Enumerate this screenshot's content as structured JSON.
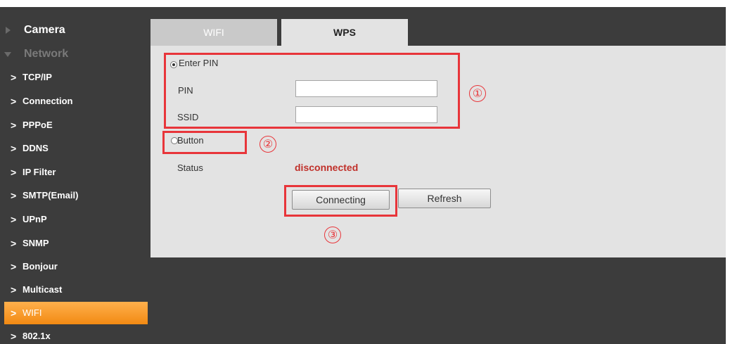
{
  "sidebar": {
    "camera": "Camera",
    "network": "Network",
    "items": [
      {
        "chevron": ">",
        "label": "TCP/IP"
      },
      {
        "chevron": ">",
        "label": "Connection"
      },
      {
        "chevron": ">",
        "label": "PPPoE"
      },
      {
        "chevron": ">",
        "label": "DDNS"
      },
      {
        "chevron": ">",
        "label": "IP Filter"
      },
      {
        "chevron": ">",
        "label": "SMTP(Email)"
      },
      {
        "chevron": ">",
        "label": "UPnP"
      },
      {
        "chevron": ">",
        "label": "SNMP"
      },
      {
        "chevron": ">",
        "label": "Bonjour"
      },
      {
        "chevron": ">",
        "label": "Multicast"
      },
      {
        "chevron": ">",
        "label": "WIFI",
        "active": true
      },
      {
        "chevron": ">",
        "label": "802.1x"
      }
    ]
  },
  "tabs": {
    "wifi": "WIFI",
    "wps": "WPS",
    "active": "WPS"
  },
  "wps": {
    "enter_pin_label": "Enter PIN",
    "enter_pin_selected": true,
    "pin_label": "PIN",
    "pin_value": "",
    "ssid_label": "SSID",
    "ssid_value": "",
    "button_label": "Button",
    "button_selected": false,
    "status_label": "Status",
    "status_value": "disconnected",
    "connect_button": "Connecting",
    "refresh_button": "Refresh"
  },
  "annotations": {
    "one": "①",
    "two": "②",
    "three": "③"
  },
  "colors": {
    "background": "#3c3c3c",
    "active_item": "#f28a13",
    "panel": "#e3e3e3",
    "highlight": "#e8353a",
    "status": "#c0302a"
  }
}
